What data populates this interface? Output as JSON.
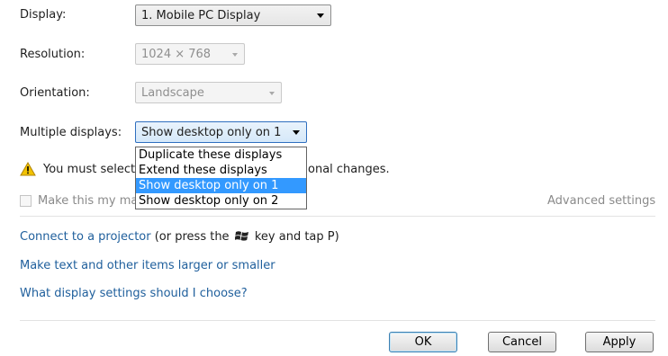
{
  "display": {
    "label": "Display:",
    "value": "1. Mobile PC Display"
  },
  "resolution": {
    "label": "Resolution:",
    "value": "1024 × 768"
  },
  "orientation": {
    "label": "Orientation:",
    "value": "Landscape"
  },
  "multiple_displays": {
    "label": "Multiple displays:",
    "value": "Show desktop only on 1",
    "options": [
      "Duplicate these displays",
      "Extend these displays",
      "Show desktop only on 1",
      "Show desktop only on 2"
    ],
    "selected_index": 2
  },
  "warning": {
    "text_before": "You must select",
    "text_after": "onal changes.",
    "icon": "warning-icon"
  },
  "make_primary": {
    "label": "Make this my ma",
    "checked": false
  },
  "advanced_settings": "Advanced settings",
  "links": {
    "projector_link": "Connect to a projector",
    "projector_hint_before": "(or press the",
    "projector_hint_icon": "windows-key-icon",
    "projector_hint_after": "key and tap P)",
    "text_size": "Make text and other items larger or smaller",
    "which_settings": "What display settings should I choose?"
  },
  "buttons": {
    "ok": "OK",
    "cancel": "Cancel",
    "apply": "Apply"
  },
  "colors": {
    "link": "#1f5f9c",
    "selection": "#3399ff",
    "warning": "#f2c200"
  }
}
